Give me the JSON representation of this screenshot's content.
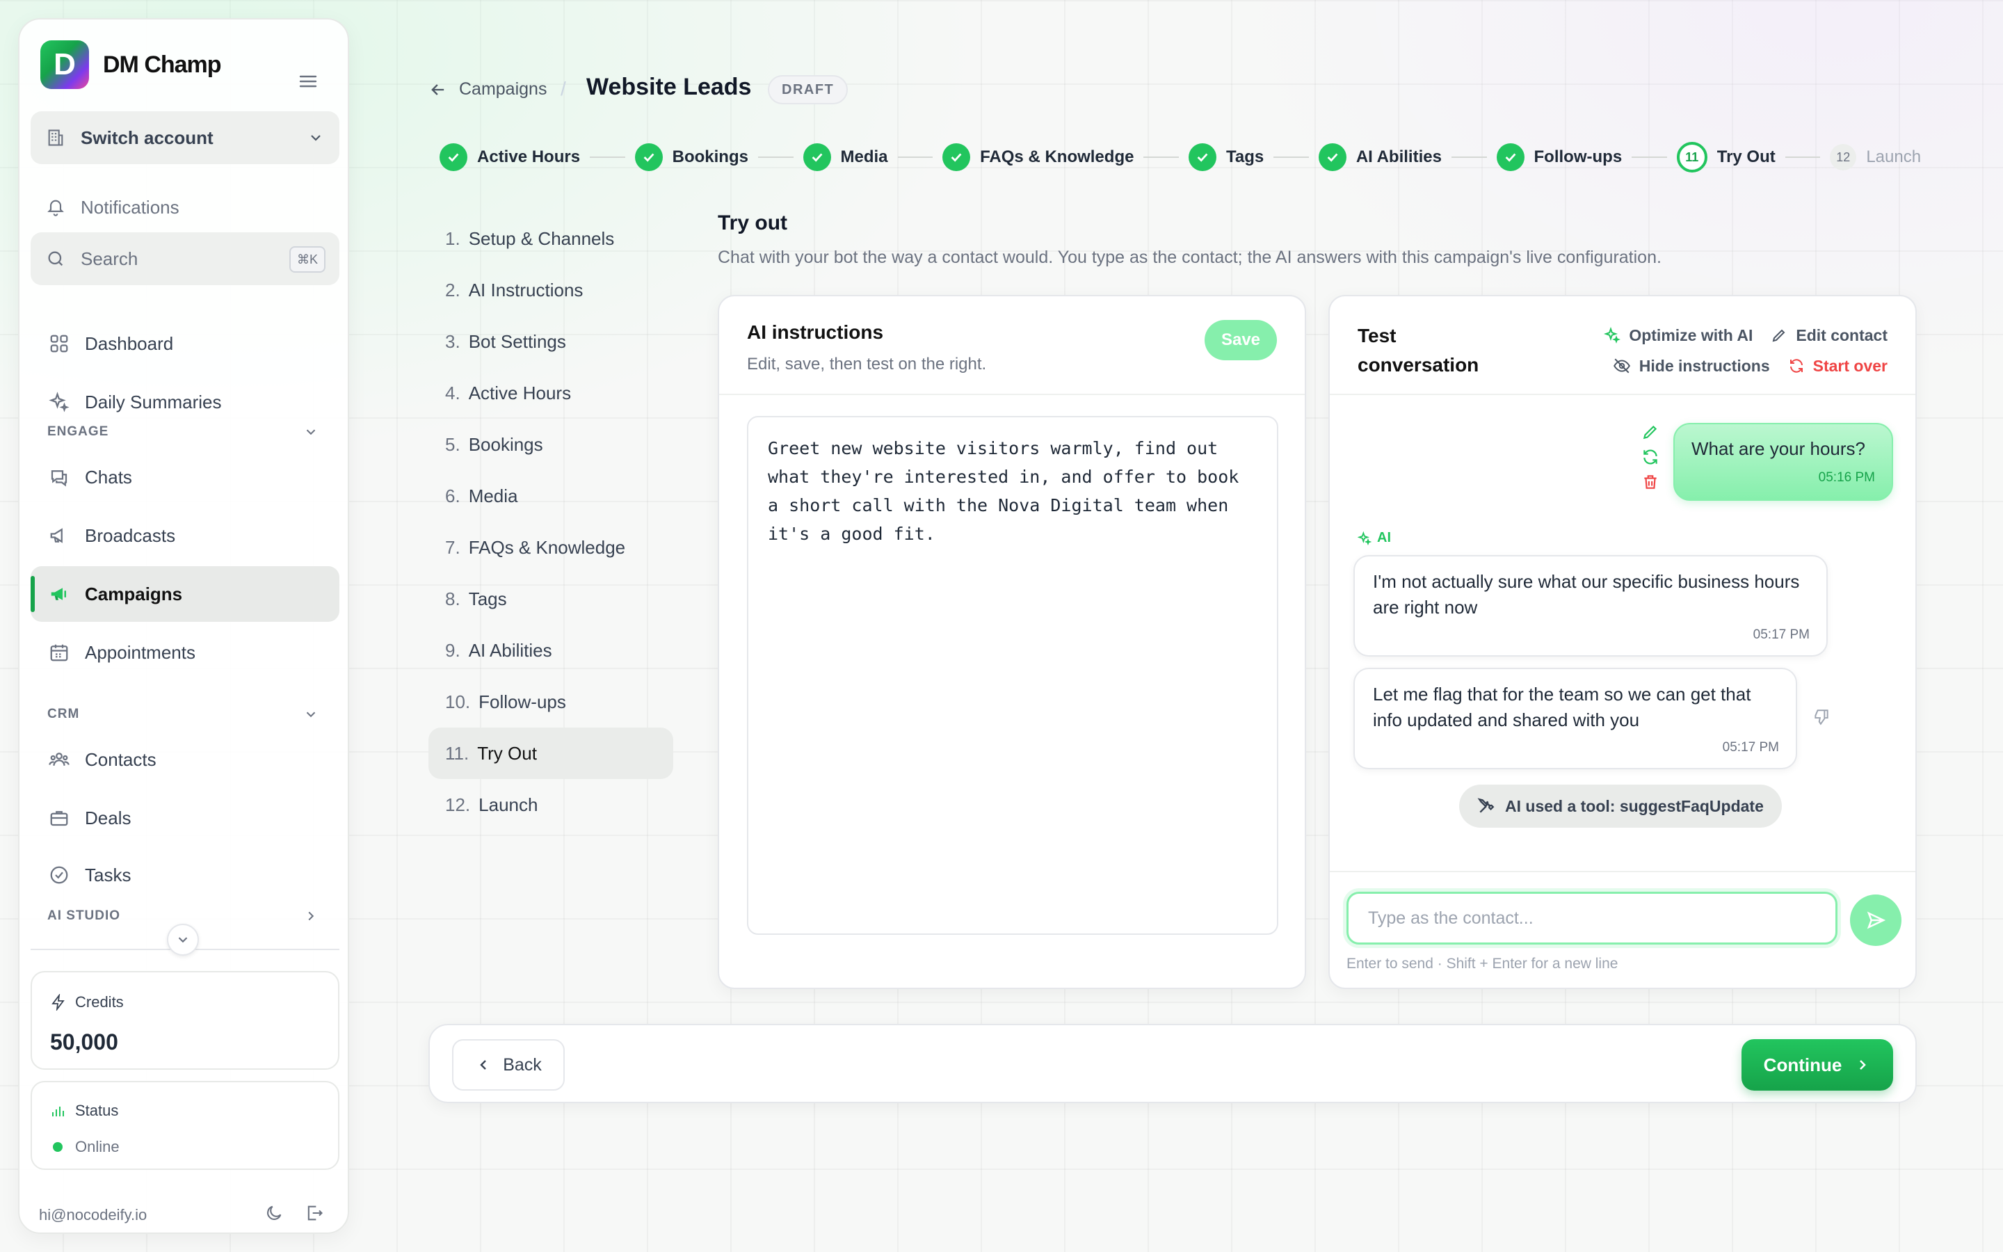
{
  "brand": {
    "name": "DM Champ",
    "logo_letter": "D"
  },
  "sidebar": {
    "switch_account": "Switch account",
    "notifications": "Notifications",
    "search": {
      "label": "Search",
      "shortcut": "⌘K"
    },
    "items": [
      {
        "label": "Dashboard",
        "icon": "grid-icon"
      },
      {
        "label": "Daily Summaries",
        "icon": "sparkles-icon"
      }
    ],
    "sections": {
      "engage": "ENGAGE",
      "crm": "CRM",
      "ai_studio": "AI STUDIO"
    },
    "engage_items": [
      {
        "label": "Chats",
        "icon": "chat-icon"
      },
      {
        "label": "Broadcasts",
        "icon": "megaphone-icon"
      },
      {
        "label": "Campaigns",
        "icon": "megaphone-filled-icon",
        "active": true
      },
      {
        "label": "Appointments",
        "icon": "calendar-icon"
      }
    ],
    "crm_items": [
      {
        "label": "Contacts",
        "icon": "users-icon"
      },
      {
        "label": "Deals",
        "icon": "briefcase-icon"
      },
      {
        "label": "Tasks",
        "icon": "check-circle-icon"
      }
    ],
    "credits": {
      "label": "Credits",
      "value": "50,000"
    },
    "status": {
      "label": "Status",
      "value": "Online",
      "color": "#22c55e"
    },
    "email": "hi@nocodeify.io"
  },
  "header": {
    "back_label": "Campaigns",
    "separator": "/",
    "title": "Website Leads",
    "badge": "DRAFT"
  },
  "stepper": {
    "steps": [
      {
        "label": "Active Hours",
        "state": "done"
      },
      {
        "label": "Bookings",
        "state": "done"
      },
      {
        "label": "Media",
        "state": "done"
      },
      {
        "label": "FAQs & Knowledge",
        "state": "done"
      },
      {
        "label": "Tags",
        "state": "done"
      },
      {
        "label": "AI Abilities",
        "state": "done"
      },
      {
        "label": "Follow-ups",
        "state": "done"
      },
      {
        "label": "Try Out",
        "state": "current",
        "number": "11"
      },
      {
        "label": "Launch",
        "state": "pending",
        "number": "12"
      }
    ]
  },
  "steplist": [
    {
      "n": "1.",
      "label": "Setup & Channels"
    },
    {
      "n": "2.",
      "label": "AI Instructions"
    },
    {
      "n": "3.",
      "label": "Bot Settings"
    },
    {
      "n": "4.",
      "label": "Active Hours"
    },
    {
      "n": "5.",
      "label": "Bookings"
    },
    {
      "n": "6.",
      "label": "Media"
    },
    {
      "n": "7.",
      "label": "FAQs & Knowledge"
    },
    {
      "n": "8.",
      "label": "Tags"
    },
    {
      "n": "9.",
      "label": "AI Abilities"
    },
    {
      "n": "10.",
      "label": "Follow-ups"
    },
    {
      "n": "11.",
      "label": "Try Out",
      "active": true
    },
    {
      "n": "12.",
      "label": "Launch"
    }
  ],
  "tryout": {
    "title": "Try out",
    "subtitle": "Chat with your bot the way a contact would. You type as the contact; the AI answers with this campaign's live configuration."
  },
  "instructions": {
    "title": "AI instructions",
    "subtitle": "Edit, save, then test on the right.",
    "save": "Save",
    "text": "Greet new website visitors warmly, find out what they're interested in, and offer to book a short call with the Nova Digital team when it's a good fit."
  },
  "chat": {
    "title": "Test conversation",
    "actions": {
      "optimize": "Optimize with AI",
      "edit_contact": "Edit contact",
      "hide_instructions": "Hide instructions",
      "start_over": "Start over"
    },
    "user_message": {
      "text": "What are your hours?",
      "time": "05:16 PM"
    },
    "ai_label": "AI",
    "ai_messages": [
      {
        "text": "I'm not actually sure what our specific business hours are right now",
        "time": "05:17 PM"
      },
      {
        "text": "Let me flag that for the team so we can get that info updated and shared with you",
        "time": "05:17 PM"
      }
    ],
    "tool_used": "AI used a tool: suggestFaqUpdate",
    "input_placeholder": "Type as the contact...",
    "hint": "Enter to send · Shift + Enter for a new line"
  },
  "footer": {
    "back": "Back",
    "continue": "Continue"
  },
  "colors": {
    "accent": "#22c55e",
    "accent_dark": "#16a34a",
    "danger": "#ef4444"
  }
}
